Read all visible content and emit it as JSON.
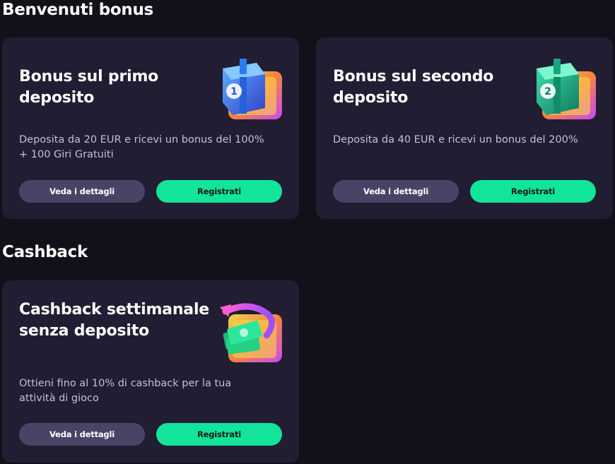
{
  "sections": [
    {
      "title": "Benvenuti bonus",
      "cards": [
        {
          "title": "Bonus sul primo deposito",
          "description": "Deposita da 20 EUR e ricevi un bonus del 100% + 100 Giri Gratuiti",
          "details_label": "Veda i dettagli",
          "register_label": "Registrati",
          "icon": "gift-box-1-icon",
          "badge": "1"
        },
        {
          "title": "Bonus sul secondo deposito",
          "description": "Deposita da 40 EUR e ricevi un bonus del 200%",
          "details_label": "Veda i dettagli",
          "register_label": "Registrati",
          "icon": "gift-box-2-icon",
          "badge": "2"
        }
      ]
    },
    {
      "title": "Cashback",
      "cards": [
        {
          "title": "Cashback settimanale senza deposito",
          "description": "Ottieni fino al 10% di cashback per la tua attività di gioco",
          "details_label": "Veda i dettagli",
          "register_label": "Registrati",
          "icon": "cashback-money-icon"
        }
      ]
    }
  ],
  "colors": {
    "background": "#121019",
    "card": "#211d33",
    "details_button": "#4b4366",
    "register_button": "#12e59a"
  }
}
